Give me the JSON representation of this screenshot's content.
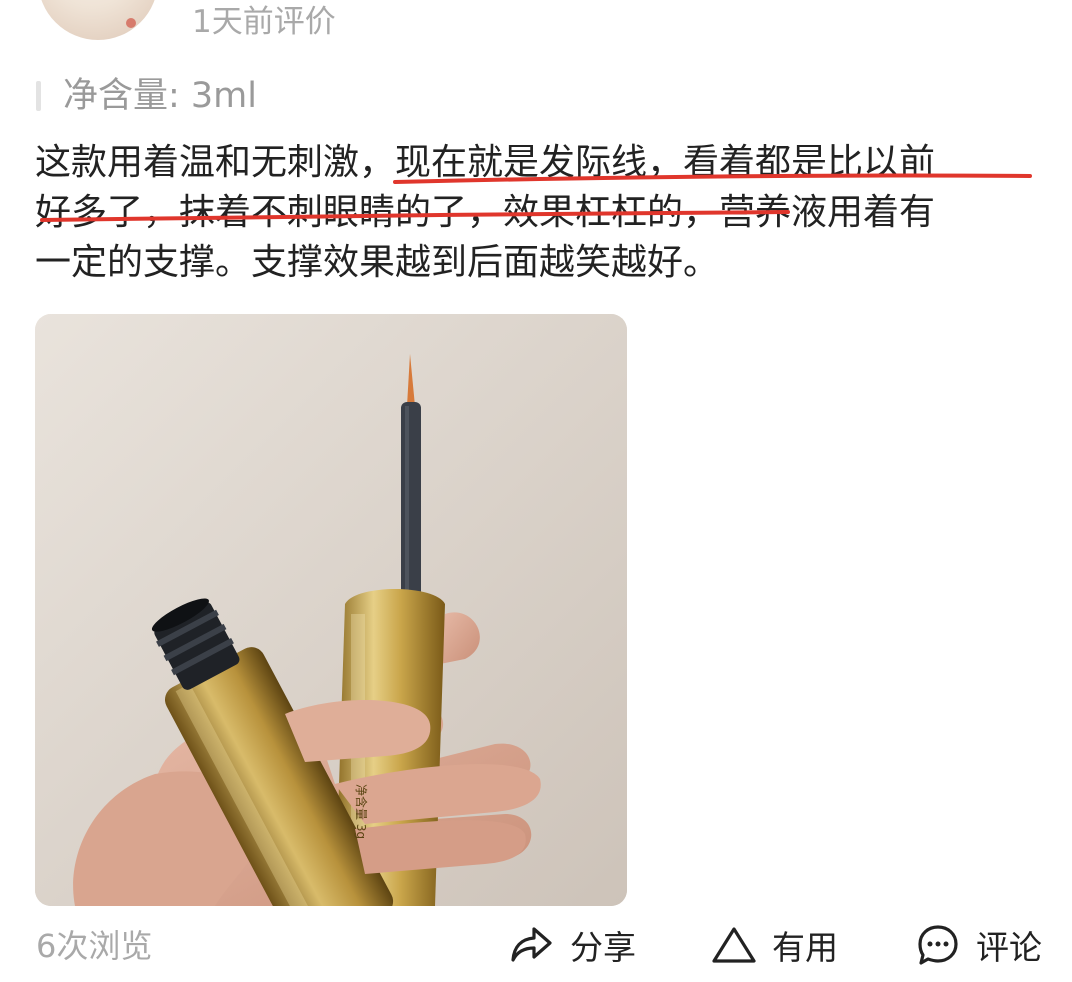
{
  "header": {
    "time_ago": "1天前评价"
  },
  "spec": {
    "text": "净含量: 3ml"
  },
  "review": {
    "lines": [
      "这款用着温和无刺激，现在就是发际线，看着都是比以前",
      "好多了，抹着不刺眼睛的了，效果杠杠的，营养液用着有",
      "一定的支撑。支撑效果越到后面越笑越好。"
    ]
  },
  "photo": {
    "label_on_bottle": "净含量 3g"
  },
  "footer": {
    "views": "6次浏览",
    "share_label": "分享",
    "useful_label": "有用",
    "comment_label": "评论"
  },
  "colors": {
    "underline": "#e0362c",
    "muted_text": "#a9a9a9",
    "body_text": "#222222",
    "gold": "#c9a54a"
  },
  "icons": [
    "share-icon",
    "triangle-useful-icon",
    "comment-bubble-icon"
  ]
}
